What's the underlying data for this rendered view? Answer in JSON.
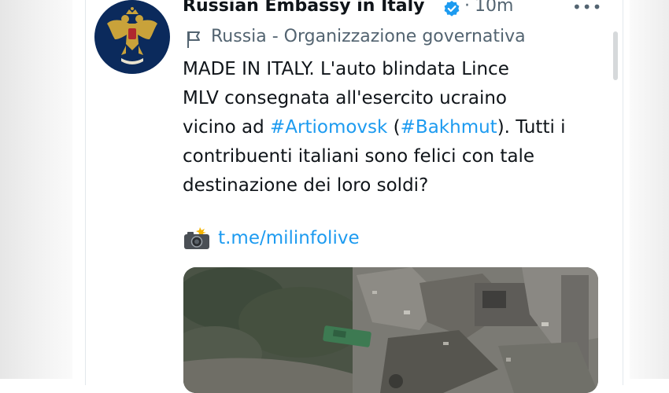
{
  "tweet": {
    "author_name": "Russian Embassy in Italy",
    "verified": true,
    "separator": "·",
    "time": "10m",
    "more_label": "•••",
    "affiliation": "Russia - Organizzazione governativa",
    "text": {
      "line1": "MADE IN ITALY. L'auto blindata Lince",
      "line2": "MLV consegnata all'esercito ucraino",
      "line3_pre": "vicino ad ",
      "hashtag1": "#Artiomovsk",
      "line3_mid": " (",
      "hashtag2": "#Bakhmut",
      "line3_post": "). Tutti i",
      "line4": "contribuenti italiani sono felici con tale",
      "line5": "destinazione dei loro soldi?"
    },
    "link_icon": "camera-flash-icon",
    "link": "t.me/milinfolive"
  },
  "colors": {
    "link_blue": "#1d9bf0",
    "text": "#0f1419",
    "secondary": "#536471",
    "avatar_bg": "#0b2a5c",
    "emblem_gold": "#c9a23a"
  }
}
